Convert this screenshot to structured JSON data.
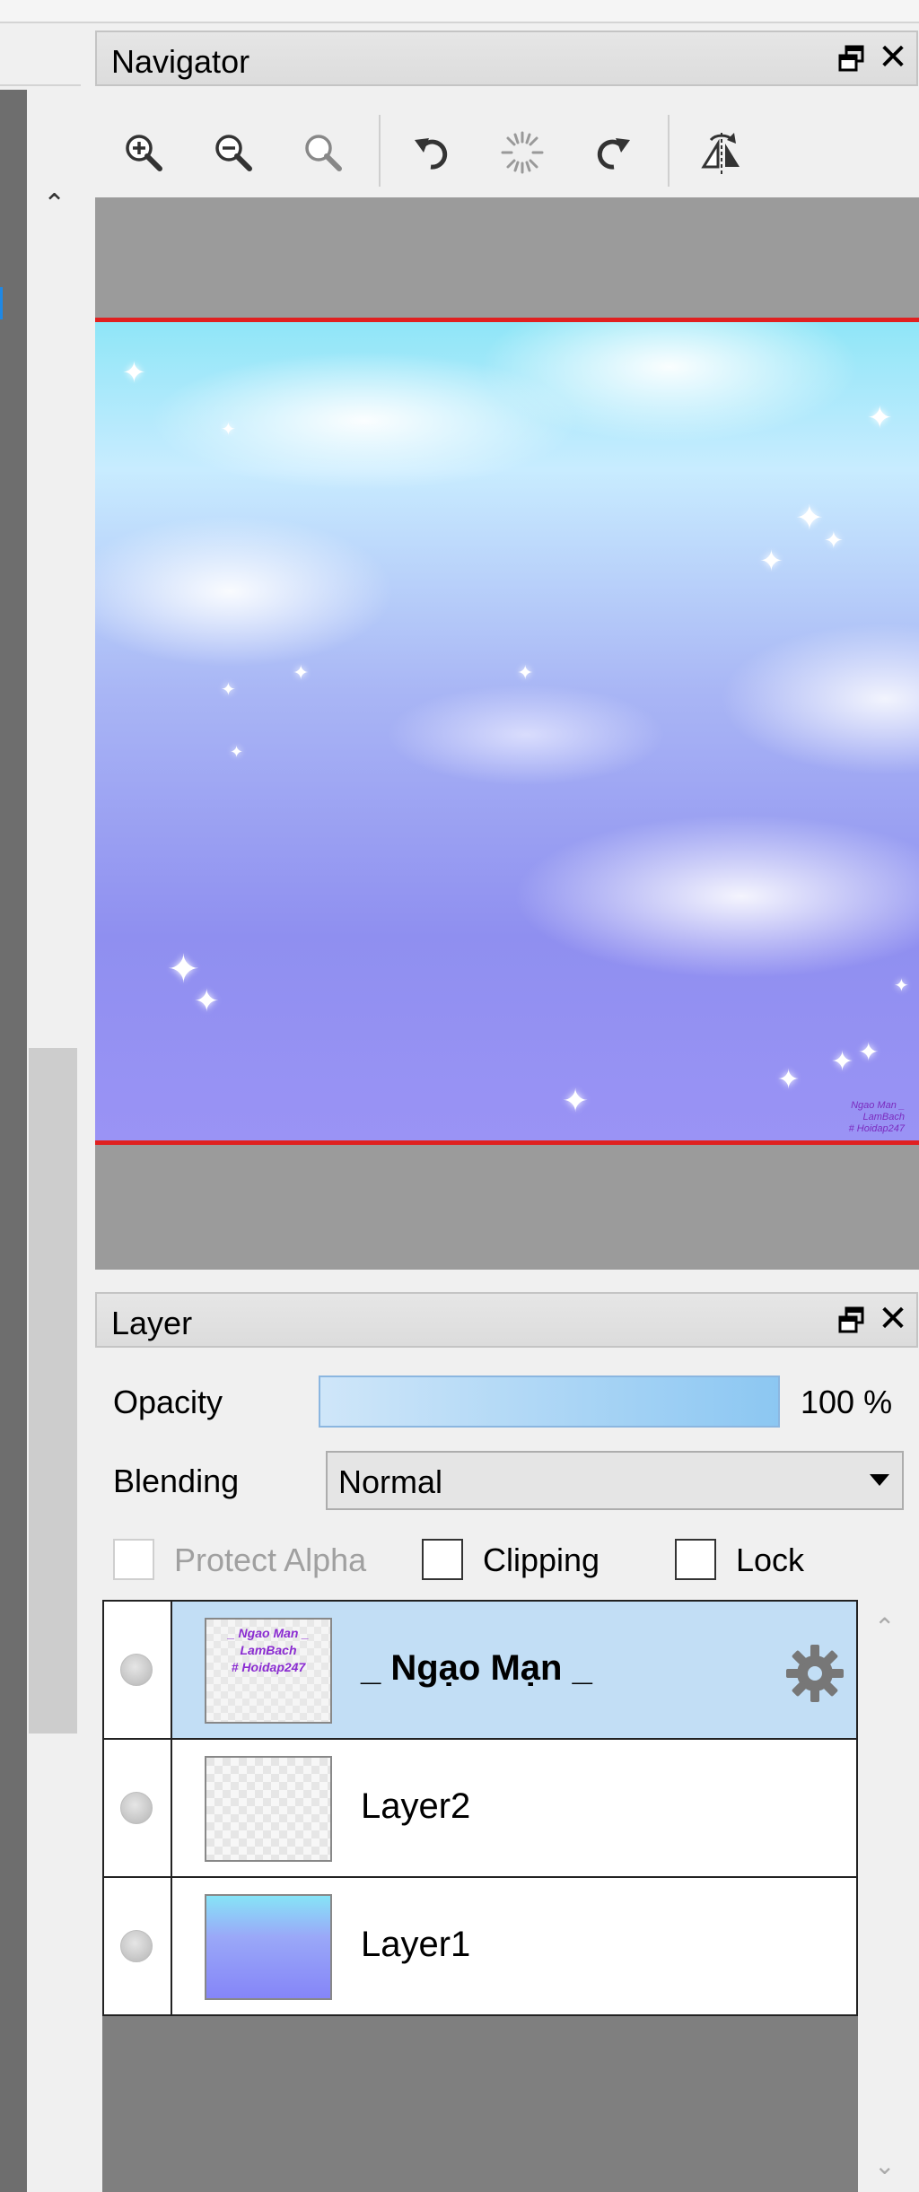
{
  "navigator": {
    "title": "Navigator",
    "toolbar": [
      {
        "name": "zoom-in-icon"
      },
      {
        "name": "zoom-out-icon"
      },
      {
        "name": "zoom-reset-icon"
      },
      {
        "name": "rotate-left-icon"
      },
      {
        "name": "rotate-reset-icon"
      },
      {
        "name": "rotate-right-icon"
      },
      {
        "name": "flip-horizontal-icon"
      }
    ],
    "watermark": [
      "Ngao Man _",
      "LamBach",
      "# Hoidap247"
    ]
  },
  "layer_panel": {
    "title": "Layer",
    "opacity_label": "Opacity",
    "opacity_value": "100 %",
    "opacity_fraction": 1.0,
    "blending_label": "Blending",
    "blending_value": "Normal",
    "protect_alpha_label": "Protect Alpha",
    "clipping_label": "Clipping",
    "lock_label": "Lock",
    "layers": [
      {
        "name": "_ Ngạo Mạn _",
        "selected": true,
        "thumb_lines": [
          "_ Ngao Man _",
          "LamBach",
          "# Hoidap247"
        ]
      },
      {
        "name": "Layer2",
        "selected": false
      },
      {
        "name": "Layer1",
        "selected": false
      }
    ]
  },
  "colors": {
    "selection": "#c2def5",
    "nav_border": "#e02020",
    "accent": "#1e88e5"
  }
}
